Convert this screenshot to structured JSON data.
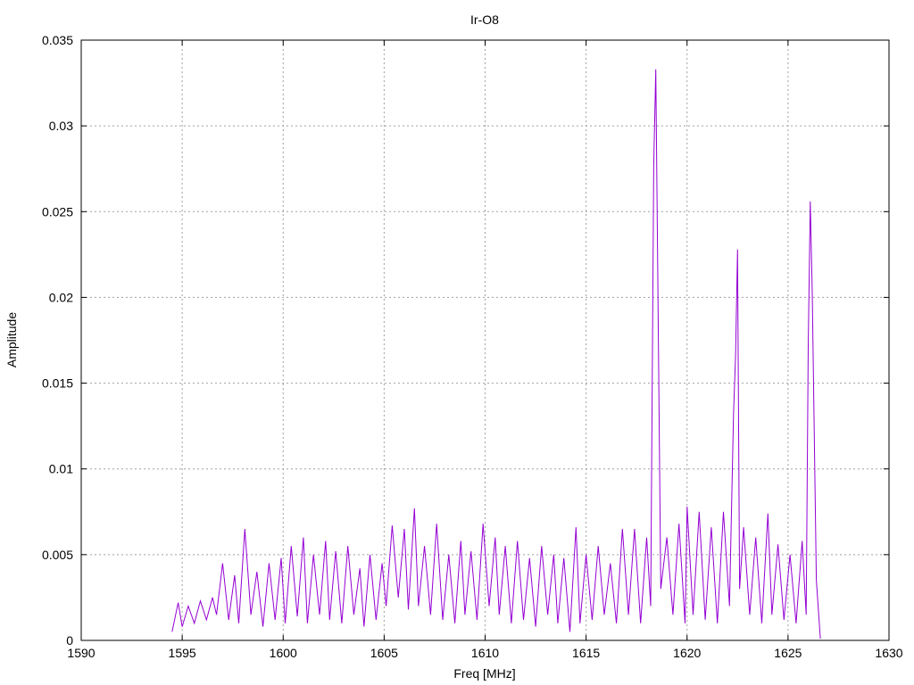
{
  "chart_data": {
    "type": "line",
    "title": "Ir-O8",
    "xlabel": "Freq [MHz]",
    "ylabel": "Amplitude",
    "xlim": [
      1590,
      1630
    ],
    "ylim": [
      0,
      0.035
    ],
    "xticks": [
      "1590",
      "1595",
      "1600",
      "1605",
      "1610",
      "1615",
      "1620",
      "1625",
      "1630"
    ],
    "yticks": [
      "0",
      "0.005",
      "0.01",
      "0.015",
      "0.02",
      "0.025",
      "0.03",
      "0.035"
    ],
    "grid": true,
    "legend": "none",
    "series": [
      {
        "color": "#9400d3",
        "x": [
          1594.5,
          1594.8,
          1595.0,
          1595.3,
          1595.6,
          1595.9,
          1596.2,
          1596.5,
          1596.7,
          1597.0,
          1597.3,
          1597.6,
          1597.8,
          1598.1,
          1598.4,
          1598.7,
          1599.0,
          1599.3,
          1599.6,
          1599.9,
          1600.1,
          1600.4,
          1600.7,
          1601.0,
          1601.2,
          1601.5,
          1601.8,
          1602.1,
          1602.3,
          1602.6,
          1602.9,
          1603.2,
          1603.5,
          1603.8,
          1604.0,
          1604.3,
          1604.6,
          1604.9,
          1605.1,
          1605.4,
          1605.7,
          1606.0,
          1606.2,
          1606.5,
          1606.7,
          1607.0,
          1607.3,
          1607.6,
          1607.9,
          1608.2,
          1608.5,
          1608.8,
          1609.0,
          1609.3,
          1609.6,
          1609.9,
          1610.2,
          1610.5,
          1610.7,
          1611.0,
          1611.3,
          1611.6,
          1611.9,
          1612.2,
          1612.5,
          1612.8,
          1613.1,
          1613.4,
          1613.6,
          1613.9,
          1614.2,
          1614.5,
          1614.7,
          1615.0,
          1615.3,
          1615.6,
          1615.9,
          1616.2,
          1616.5,
          1616.8,
          1617.1,
          1617.4,
          1617.7,
          1618.0,
          1618.2,
          1618.35,
          1618.45,
          1618.55,
          1618.7,
          1619.0,
          1619.3,
          1619.6,
          1619.9,
          1620.0,
          1620.3,
          1620.6,
          1620.9,
          1621.2,
          1621.5,
          1621.8,
          1622.1,
          1622.3,
          1622.4,
          1622.5,
          1622.6,
          1622.8,
          1623.1,
          1623.4,
          1623.7,
          1624.0,
          1624.2,
          1624.5,
          1624.8,
          1625.1,
          1625.4,
          1625.7,
          1625.9,
          1626.0,
          1626.1,
          1626.2,
          1626.4,
          1626.6
        ],
        "y": [
          0.0005,
          0.0022,
          0.0008,
          0.002,
          0.001,
          0.0023,
          0.0012,
          0.0025,
          0.0015,
          0.0045,
          0.0012,
          0.0038,
          0.001,
          0.0065,
          0.0015,
          0.004,
          0.0008,
          0.0045,
          0.0012,
          0.0048,
          0.001,
          0.0055,
          0.0014,
          0.006,
          0.001,
          0.005,
          0.0015,
          0.0058,
          0.0012,
          0.0052,
          0.001,
          0.0055,
          0.0015,
          0.0042,
          0.0008,
          0.005,
          0.0012,
          0.0045,
          0.002,
          0.0067,
          0.0025,
          0.0065,
          0.0018,
          0.0077,
          0.002,
          0.0055,
          0.0015,
          0.0068,
          0.0012,
          0.005,
          0.001,
          0.0058,
          0.0015,
          0.0052,
          0.0012,
          0.0068,
          0.002,
          0.006,
          0.0015,
          0.0055,
          0.001,
          0.0058,
          0.0012,
          0.0048,
          0.0008,
          0.0055,
          0.0015,
          0.005,
          0.001,
          0.0048,
          0.0005,
          0.0066,
          0.001,
          0.005,
          0.0012,
          0.0055,
          0.0015,
          0.0045,
          0.001,
          0.0065,
          0.0015,
          0.0065,
          0.001,
          0.006,
          0.002,
          0.0277,
          0.0333,
          0.0215,
          0.003,
          0.006,
          0.0015,
          0.0068,
          0.001,
          0.0078,
          0.0015,
          0.0075,
          0.0012,
          0.0066,
          0.001,
          0.0075,
          0.002,
          0.0132,
          0.0166,
          0.0228,
          0.003,
          0.0066,
          0.0015,
          0.006,
          0.001,
          0.0074,
          0.0015,
          0.0056,
          0.0012,
          0.005,
          0.001,
          0.0058,
          0.0015,
          0.0172,
          0.0256,
          0.0203,
          0.0035,
          0.0001
        ]
      }
    ]
  }
}
